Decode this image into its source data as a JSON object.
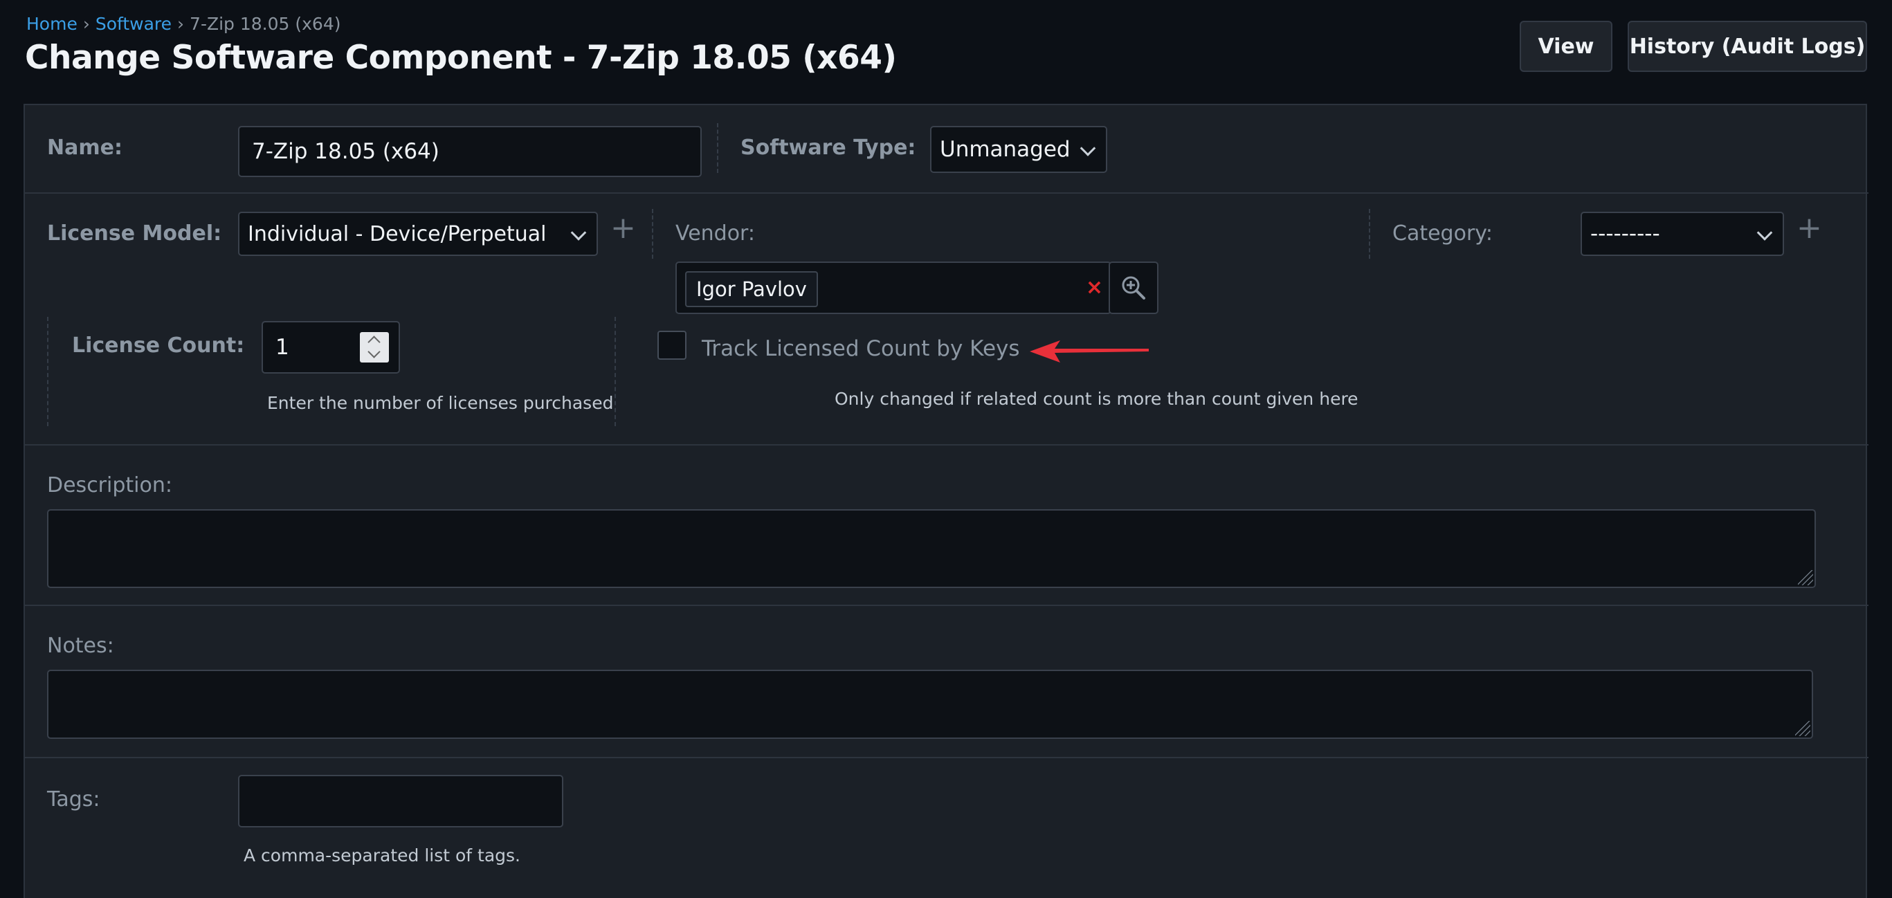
{
  "breadcrumb": {
    "home": "Home",
    "software": "Software",
    "current": "7-Zip 18.05 (x64)",
    "separator": "›"
  },
  "page_title": "Change Software Component - 7-Zip 18.05 (x64)",
  "header_buttons": {
    "view": "View",
    "history": "History (Audit Logs)"
  },
  "form": {
    "name": {
      "label": "Name:",
      "value": "7-Zip 18.05 (x64)"
    },
    "software_type": {
      "label": "Software Type:",
      "selected": "Unmanaged"
    },
    "license_model": {
      "label": "License Model:",
      "selected": "Individual - Device/Perpetual"
    },
    "vendor": {
      "label": "Vendor:",
      "selected_tag": "Igor Pavlov",
      "clear_symbol": "×"
    },
    "category": {
      "label": "Category:",
      "selected": "---------"
    },
    "license_count": {
      "label": "License Count:",
      "value": "1",
      "help": "Enter the number of licenses purchased"
    },
    "track_keys": {
      "label": "Track Licensed Count by Keys",
      "checked": false,
      "help": "Only changed if related count is more than count given here"
    },
    "description": {
      "label": "Description:",
      "value": ""
    },
    "notes": {
      "label": "Notes:",
      "value": ""
    },
    "tags": {
      "label": "Tags:",
      "value": "",
      "help": "A comma-separated list of tags."
    }
  },
  "add_symbol": "+",
  "colors": {
    "background": "#0c1016",
    "panel": "#1b2027",
    "link": "#3b9fe6",
    "annotation_arrow": "#e8303a",
    "clear_red": "#e0292b"
  }
}
